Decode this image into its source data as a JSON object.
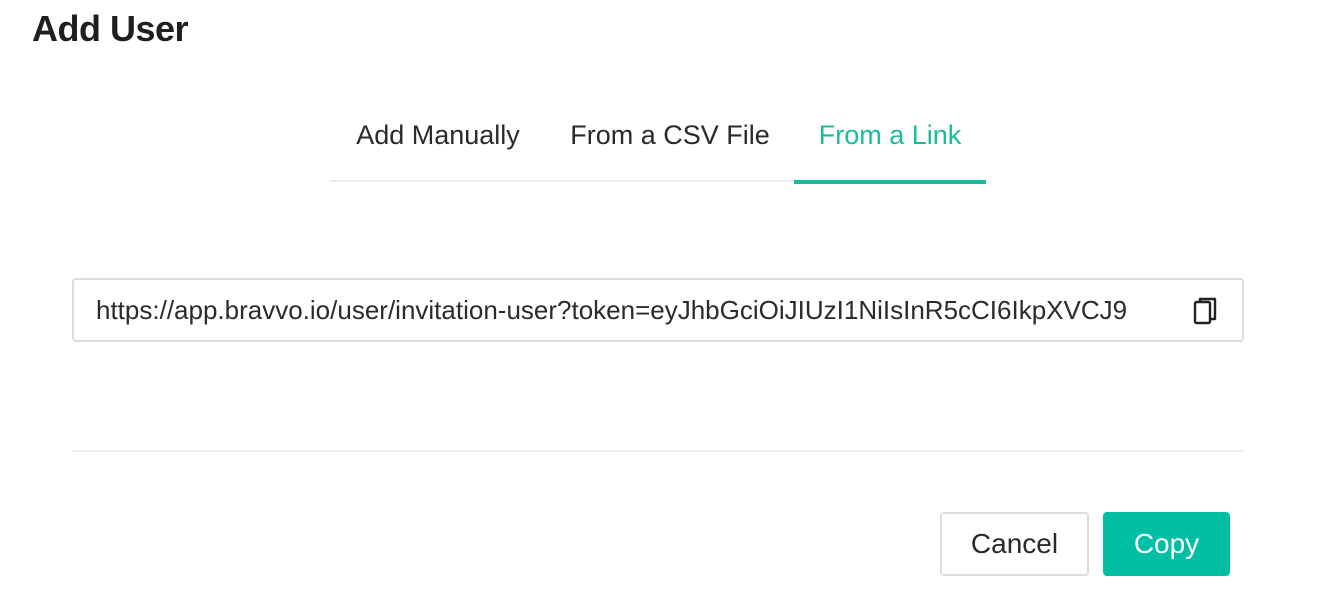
{
  "dialog": {
    "title": "Add User"
  },
  "tabs": [
    {
      "label": "Add Manually",
      "active": false
    },
    {
      "label": "From a CSV File",
      "active": false
    },
    {
      "label": "From a Link",
      "active": true
    }
  ],
  "link_field": {
    "value": "https://app.bravvo.io/user/invitation-user?token=eyJhbGciOiJIUzI1NiIsInR5cCI6IkpXVCJ9",
    "icon": "copy-icon"
  },
  "footer": {
    "cancel_label": "Cancel",
    "copy_label": "Copy"
  },
  "colors": {
    "accent": "#1abc9c",
    "primary_button": "#00bfa5",
    "border": "#dcdcdc"
  }
}
